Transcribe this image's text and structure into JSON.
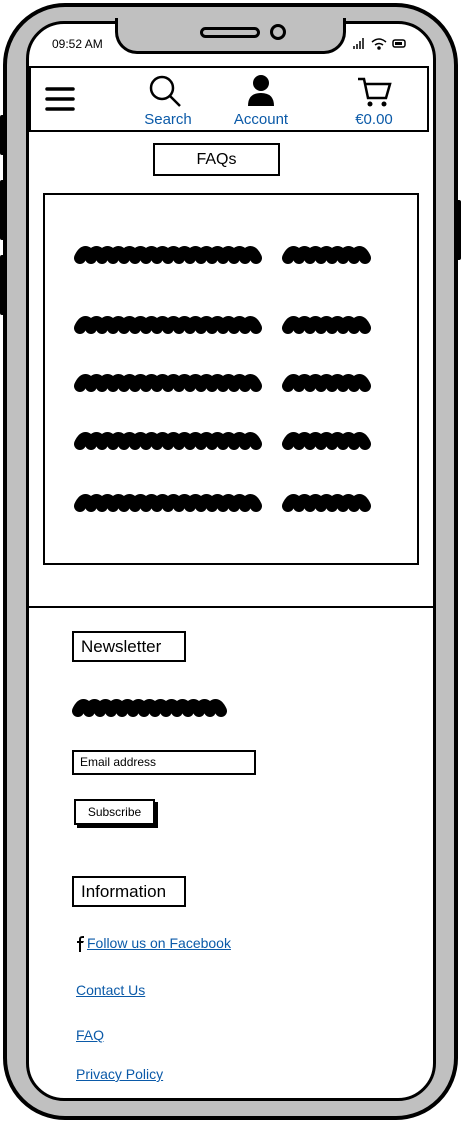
{
  "status_bar": {
    "time": "09:52 AM"
  },
  "header": {
    "search_label": "Search",
    "account_label": "Account",
    "cart_total": "€0.00"
  },
  "page_title": "FAQs",
  "newsletter": {
    "heading": "Newsletter",
    "email_placeholder": "Email address",
    "subscribe_label": "Subscribe"
  },
  "information": {
    "heading": "Information",
    "links": [
      "Follow us on Facebook",
      "Contact Us",
      "FAQ",
      "Privacy Policy"
    ]
  },
  "colors": {
    "link": "#0b5aa8",
    "bezel": "#c0c0c0"
  }
}
